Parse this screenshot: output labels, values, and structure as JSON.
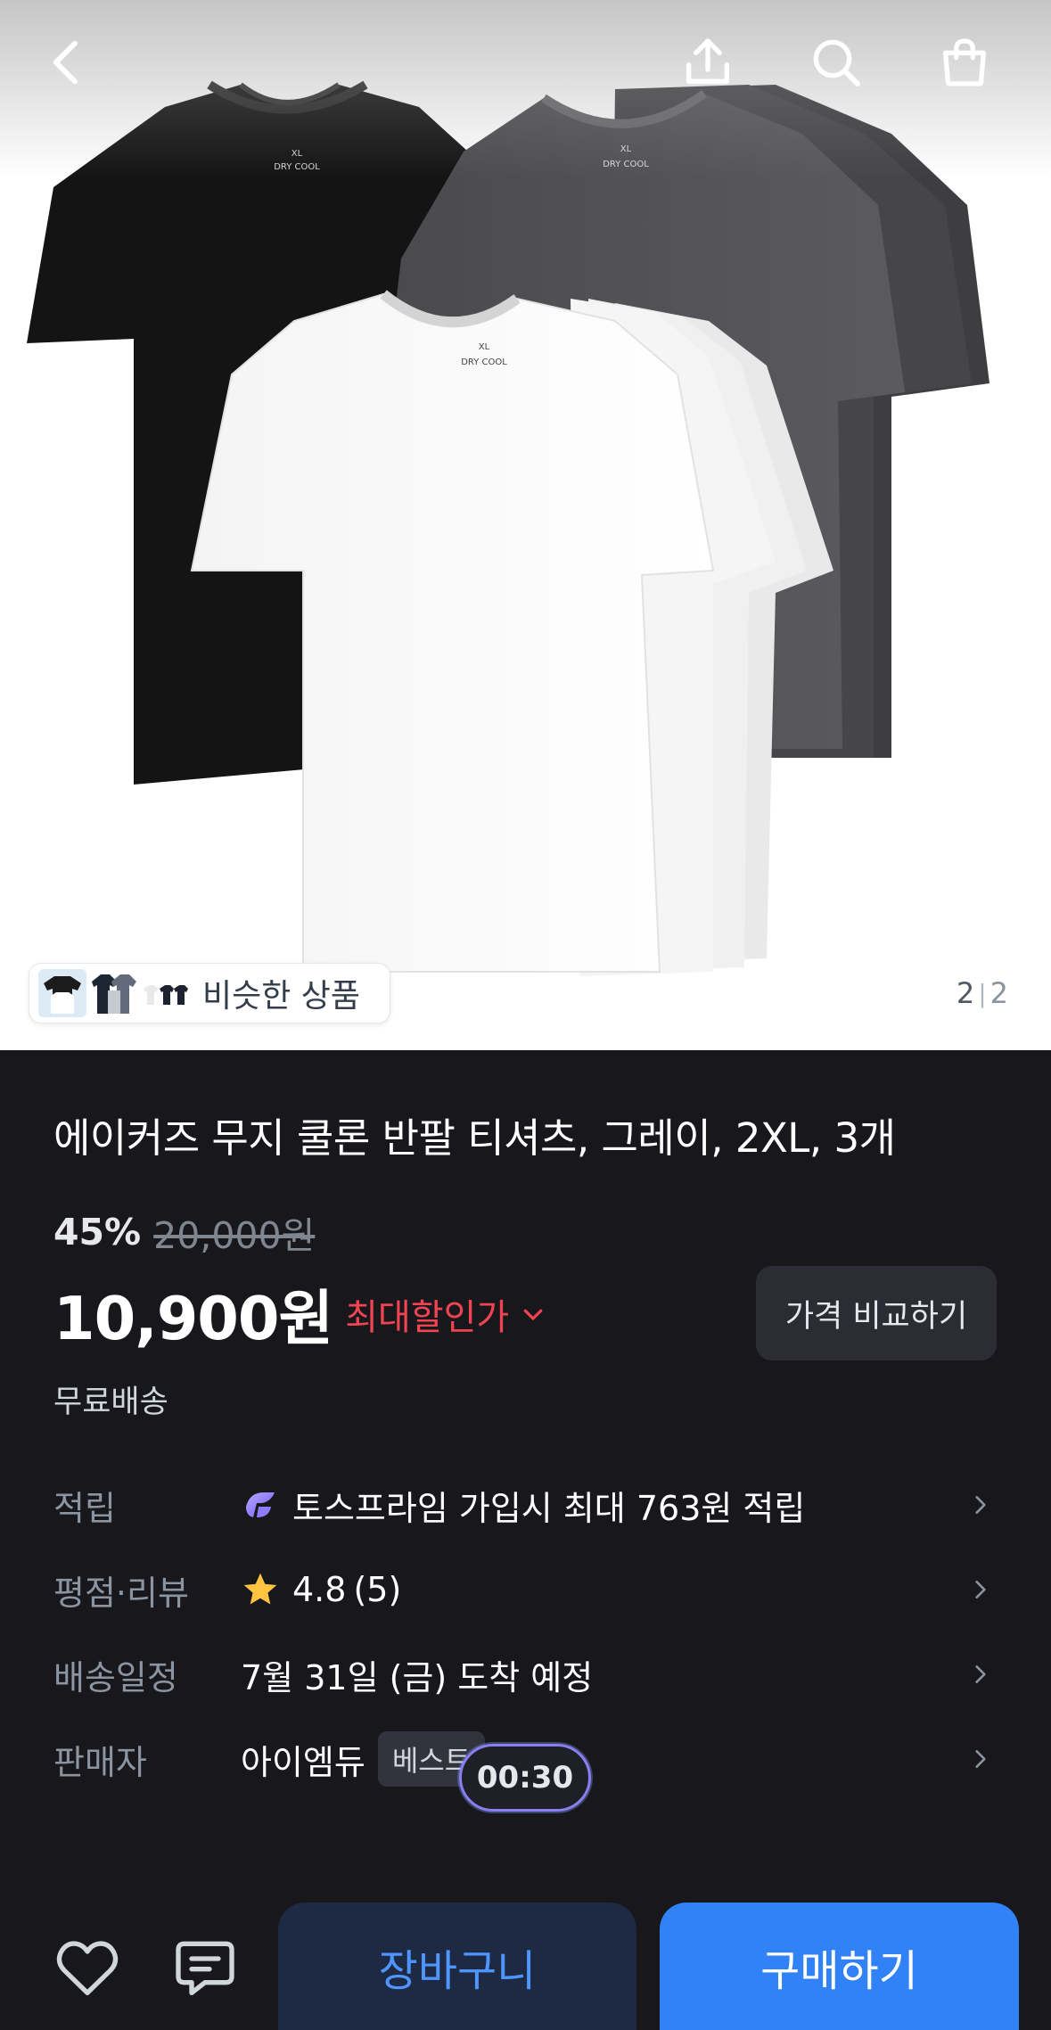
{
  "hero": {
    "similar_label": "비슷한 상품",
    "page_current": "2",
    "page_total": "2",
    "shirt_print_size": "XL",
    "shirt_print_brand": "DRY COOL"
  },
  "product": {
    "title": "에이커즈 무지 쿨론 반팔 티셔츠, 그레이, 2XL, 3개",
    "discount": "45%",
    "original_price": "20,000원",
    "price": "10,900원",
    "max_discount_label": "최대할인가",
    "compare_button": "가격 비교하기",
    "shipping": "무료배송"
  },
  "info": {
    "points": {
      "label": "적립",
      "value": "토스프라임 가입시 최대 763원 적립"
    },
    "rating": {
      "label": "평점·리뷰",
      "score": "4.8",
      "count": "(5)"
    },
    "delivery": {
      "label": "배송일정",
      "value": "7월 31일 (금) 도착 예정"
    },
    "seller": {
      "label": "판매자",
      "value": "아이엠듀",
      "badge": "베스트"
    }
  },
  "timer": "00:30",
  "bottom": {
    "cart_label": "장바구니",
    "buy_label": "구매하기"
  },
  "colors": {
    "accent": "#3182f6",
    "discount_red": "#f04452",
    "background": "#17171c"
  }
}
